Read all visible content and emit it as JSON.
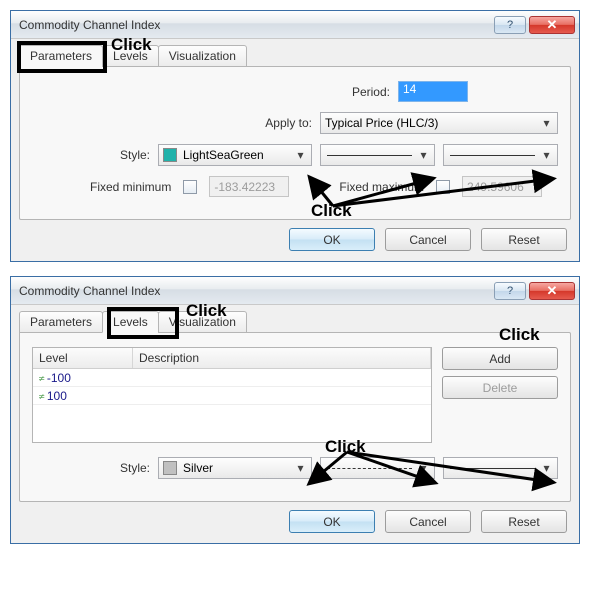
{
  "dialog1": {
    "title": "Commodity Channel Index",
    "tabs": [
      "Parameters",
      "Levels",
      "Visualization"
    ],
    "active_tab": 0,
    "period_label": "Period:",
    "period_value": "14",
    "apply_label": "Apply to:",
    "apply_value": "Typical Price (HLC/3)",
    "style_label": "Style:",
    "style_color_name": "LightSeaGreen",
    "style_color_hex": "#20B2AA",
    "fixed_min_label": "Fixed minimum",
    "fixed_min_value": "-183.42223",
    "fixed_max_label": "Fixed maximum",
    "fixed_max_value": "249.59606",
    "buttons": {
      "ok": "OK",
      "cancel": "Cancel",
      "reset": "Reset"
    }
  },
  "dialog2": {
    "title": "Commodity Channel Index",
    "tabs": [
      "Parameters",
      "Levels",
      "Visualization"
    ],
    "active_tab": 1,
    "grid_headers": [
      "Level",
      "Description"
    ],
    "levels": [
      {
        "value": "-100",
        "description": ""
      },
      {
        "value": "100",
        "description": ""
      }
    ],
    "add_label": "Add",
    "delete_label": "Delete",
    "style_label": "Style:",
    "style_color_name": "Silver",
    "style_color_hex": "#C0C0C0",
    "buttons": {
      "ok": "OK",
      "cancel": "Cancel",
      "reset": "Reset"
    }
  },
  "annotations": {
    "click": "Click"
  }
}
